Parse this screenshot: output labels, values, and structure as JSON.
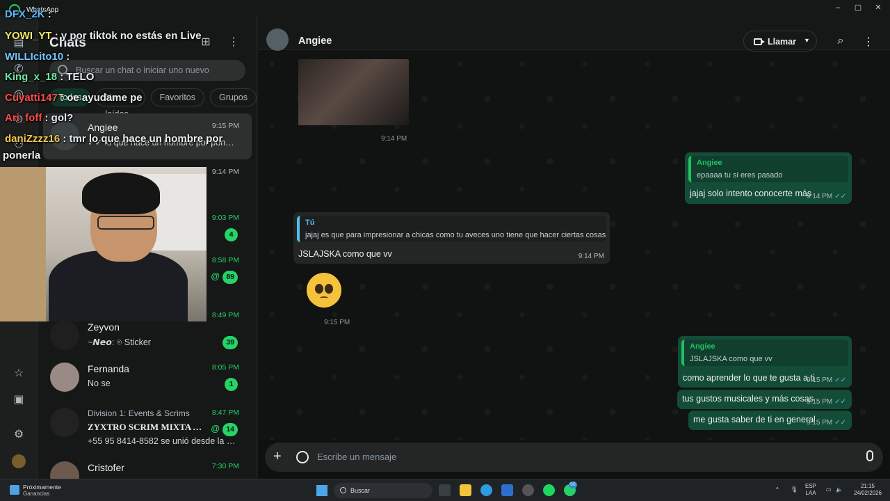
{
  "window": {
    "app_title": "WhatsApp",
    "min": "–",
    "max": "▢",
    "close": "✕"
  },
  "sidebar_panel": {
    "title": "Chats",
    "search_placeholder": "Buscar un chat o iniciar uno nuevo",
    "filters": [
      "Todos",
      "No leídos",
      "Favoritos",
      "Grupos"
    ],
    "chats": [
      {
        "name": "Angiee",
        "preview": "✓✓ lo que hace un hombre por ponerla",
        "time": "9:15 PM",
        "unread": false,
        "badge": ""
      },
      {
        "name": "",
        "preview": "",
        "time": "9:14 PM",
        "unread": false,
        "badge": ""
      },
      {
        "name": "",
        "preview": "",
        "time": "9:03 PM",
        "unread": true,
        "badge": "4"
      },
      {
        "name": "",
        "preview": "",
        "time": "8:58 PM",
        "unread": true,
        "badge": "89",
        "mention": "@"
      },
      {
        "name": "",
        "preview": "",
        "time": "8:49 PM",
        "unread": true,
        "badge": ""
      },
      {
        "name": "Zeyvon",
        "preview": "~𝙉𝙚𝙤: ⌾ Sticker",
        "time": "",
        "unread": true,
        "badge": "39"
      },
      {
        "name": "Fernanda",
        "preview": "No se",
        "time": "8:05 PM",
        "unread": true,
        "badge": "1"
      },
      {
        "name": "Division 1: Events & Scrims",
        "preview": "+55 95 8414-8582 se unió desde la com...",
        "subname": "ZYXTRO SCRIM MIXTA A...",
        "time": "8:47 PM",
        "unread": true,
        "badge": "14",
        "mention": "@"
      },
      {
        "name": "Cristofer",
        "preview": "",
        "time": "7:30 PM",
        "unread": true,
        "badge": ""
      }
    ]
  },
  "conversation": {
    "contact": "Angiee",
    "call_label": "Llamar",
    "composer_placeholder": "Escribe un mensaje",
    "messages": [
      {
        "kind": "image",
        "time": "9:14 PM"
      },
      {
        "kind": "out",
        "quote_author": "Angiee",
        "quote_text": "epaaaa tu si eres pasado",
        "text": "jajaj solo intento conocerte más",
        "time": "9:14 PM"
      },
      {
        "kind": "in",
        "quote_author": "Tú",
        "quote_text": "jajaj es que para impresionar a chicas como tu aveces uno tiene que hacer ciertas cosas",
        "text": "JSLAJSKA como que vv",
        "time": "9:14 PM"
      },
      {
        "kind": "emoji",
        "time": "9:15 PM"
      },
      {
        "kind": "out",
        "quote_author": "Angiee",
        "quote_text": "JSLAJSKA como que vv",
        "text": "como aprender lo que te gusta a ti",
        "time": "9:15 PM"
      },
      {
        "kind": "out",
        "text": "tus gustos musicales y más cosas",
        "time": "9:15 PM"
      },
      {
        "kind": "out",
        "text": "me gusta saber de ti en general",
        "time": "9:15 PM"
      }
    ]
  },
  "stream_chat": [
    {
      "user": "DFX_2K",
      "text": ":"
    },
    {
      "user": "YOWI_YT",
      "text": ": y por tiktok no estás en Live"
    },
    {
      "user": "WILLIcito10",
      "text": ":"
    },
    {
      "user": "King_x_18",
      "text": ": TELO"
    },
    {
      "user": "Cuyatti147",
      "text": ": oe ayudame pe"
    },
    {
      "user": "Ari_foff",
      "text": ": gol?"
    },
    {
      "user": "daniZzzz16",
      "text": ": tmr lo que hace un hombre por"
    },
    {
      "user": "",
      "text": "ponerla"
    }
  ],
  "stream_colors": [
    "#5fb7ff",
    "#f2e86b",
    "#73c7ff",
    "#6ee8a6",
    "#ff4a4a",
    "#ff4a4a",
    "#f2c94c"
  ],
  "taskbar": {
    "weather_title": "Próximamente",
    "weather_sub": "Ganancias",
    "search_label": "Buscar",
    "lang_top": "ESP",
    "lang_bottom": "LAA",
    "time": "21:15",
    "date": "24/02/2026",
    "whatsapp_badge": "66"
  }
}
